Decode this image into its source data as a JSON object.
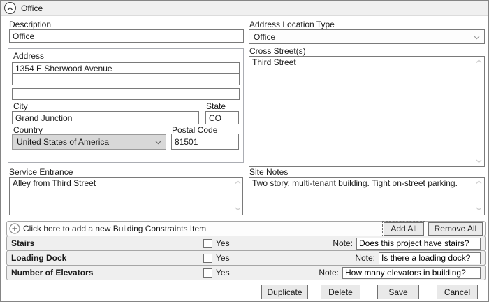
{
  "header": {
    "title": "Office"
  },
  "icons": {
    "expander": "chevron-up",
    "add_item": "plus-circle",
    "dropdown": "chevron-down",
    "scroll_up": "chevron-up",
    "scroll_down": "chevron-down"
  },
  "left": {
    "description": {
      "label": "Description",
      "value": "Office"
    },
    "address": {
      "label": "Address",
      "lines": [
        "1354 E Sherwood Avenue",
        "",
        ""
      ],
      "city": {
        "label": "City",
        "value": "Grand Junction"
      },
      "state": {
        "label": "State",
        "value": "CO"
      },
      "country": {
        "label": "Country",
        "value": "United States of America"
      },
      "postal": {
        "label": "Postal Code",
        "value": "81501"
      }
    },
    "service_entrance": {
      "label": "Service Entrance",
      "value": "Alley from Third Street"
    }
  },
  "right": {
    "location_type": {
      "label": "Address Location Type",
      "value": "Office"
    },
    "cross_streets": {
      "label": "Cross Street(s)",
      "value": "Third Street"
    },
    "site_notes": {
      "label": "Site Notes",
      "value": "Two story, multi-tenant building. Tight on-street parking."
    }
  },
  "constraints": {
    "add_prompt": "Click here to add a new Building Constraints Item",
    "add_all_label": "Add All",
    "remove_all_label": "Remove All",
    "checkbox_label": "Yes",
    "note_label": "Note:",
    "items": [
      {
        "name": "Stairs",
        "checked": false,
        "note": "Does this project have stairs?"
      },
      {
        "name": "Loading Dock",
        "checked": false,
        "note": "Is there a loading dock?"
      },
      {
        "name": "Number of Elevators",
        "checked": false,
        "note": "How many elevators in building?"
      }
    ]
  },
  "footer": {
    "buttons": [
      "Duplicate",
      "Delete",
      "Save",
      "Cancel"
    ]
  },
  "colors": {
    "header_bg": "#f0f0f0",
    "row_bg": "#efefef",
    "addrow_bg": "#fdfdfd",
    "button_bg": "#e9e9e9",
    "input_border": "#7a7a7a",
    "group_border": "#abadb3",
    "dropdown_gray_bg": "#d8d8d8",
    "panel_border": "#858585"
  }
}
